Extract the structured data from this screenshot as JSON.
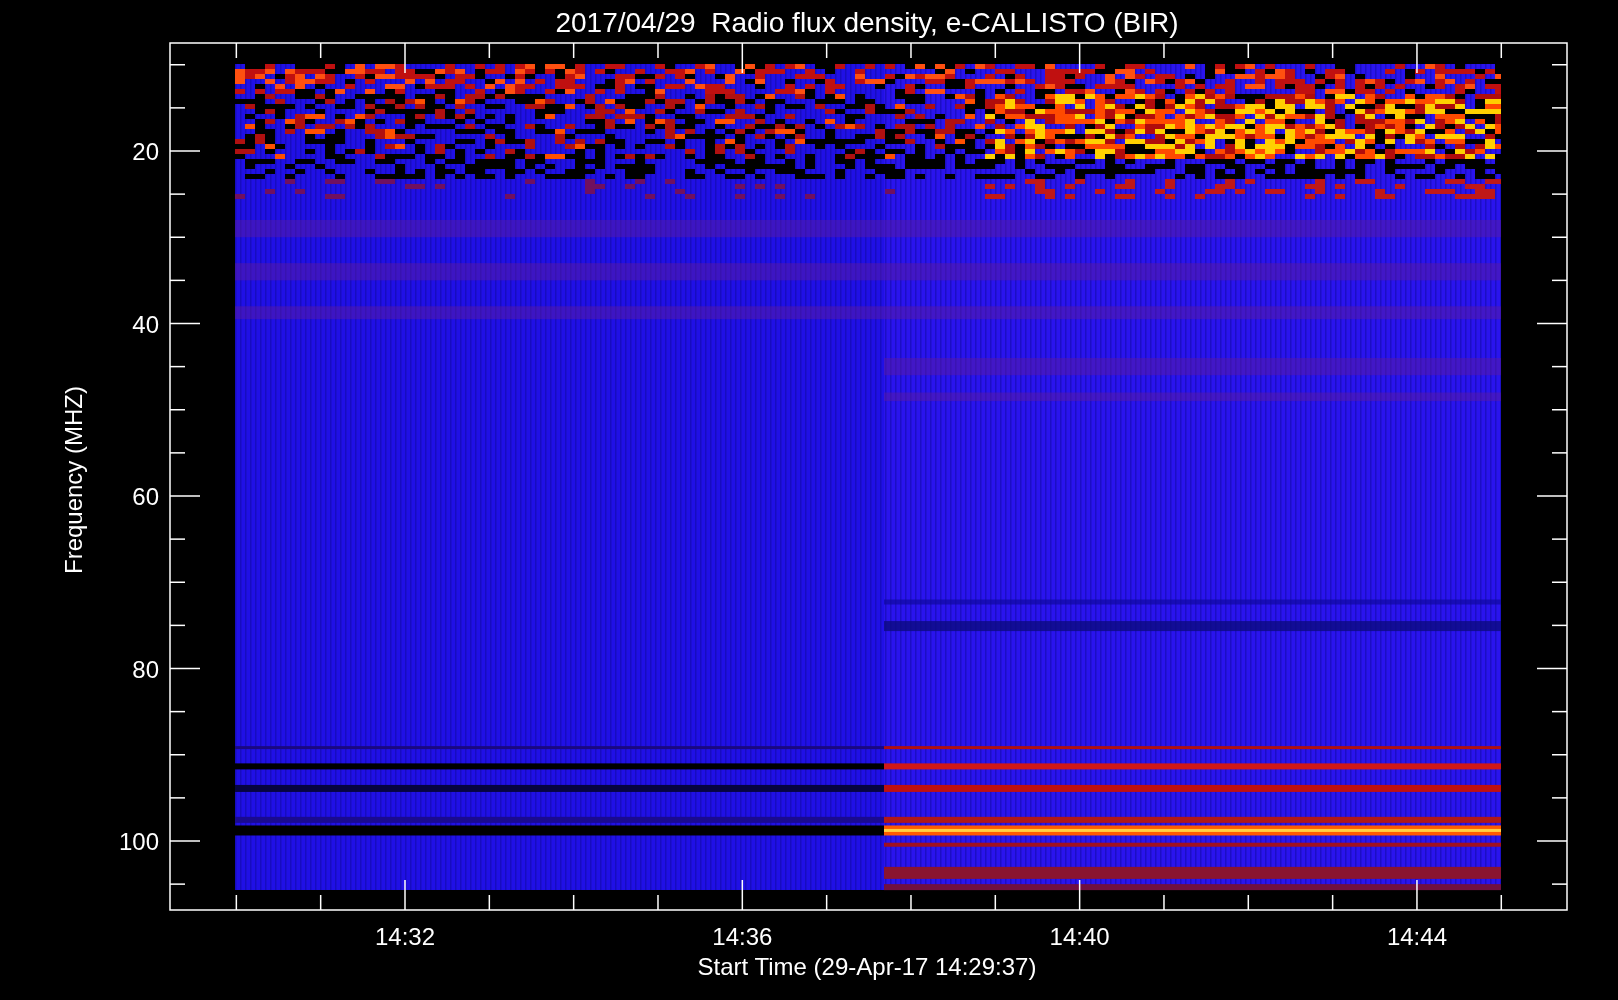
{
  "title": "2017/04/29  Radio flux density, e-CALLISTO (BIR)",
  "plot": {
    "xlabel": "Start Time (29-Apr-17 14:29:37)",
    "ylabel": "Frequency (MHZ)",
    "xticks": [
      "14:32",
      "14:36",
      "14:40",
      "14:44"
    ],
    "yticks": [
      "20",
      "40",
      "60",
      "80",
      "100"
    ]
  }
}
